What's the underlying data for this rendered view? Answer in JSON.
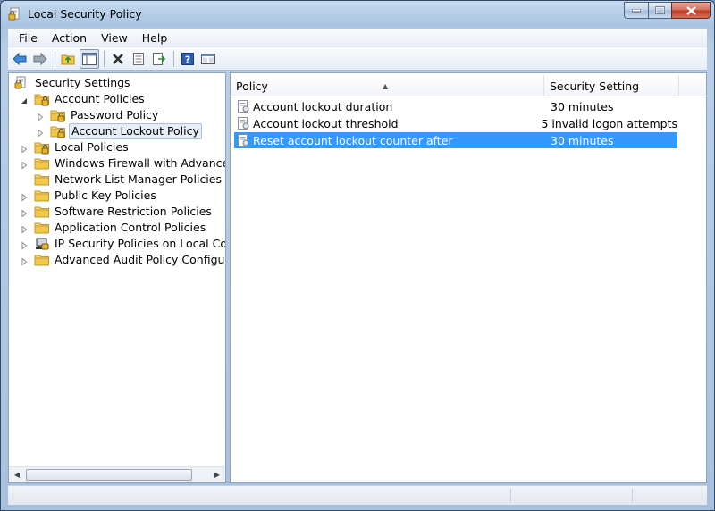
{
  "window": {
    "title": "Local Security Policy",
    "caption_buttons": [
      "minimize",
      "maximize",
      "close"
    ]
  },
  "menu": {
    "items": [
      {
        "label": "File"
      },
      {
        "label": "Action"
      },
      {
        "label": "View"
      },
      {
        "label": "Help"
      }
    ]
  },
  "toolbar": {
    "buttons": [
      {
        "icon": "back-arrow-icon"
      },
      {
        "icon": "forward-arrow-icon"
      },
      {
        "icon": "up-folder-icon"
      },
      {
        "icon": "show-hide-tree-icon",
        "pressed": true
      },
      {
        "icon": "delete-icon"
      },
      {
        "icon": "properties-icon"
      },
      {
        "icon": "export-list-icon"
      },
      {
        "icon": "help-icon"
      },
      {
        "icon": "mmc-view-icon"
      }
    ]
  },
  "tree": {
    "items": [
      {
        "label": "Security Settings",
        "level": 0,
        "icon": "security-settings-icon",
        "expander": "none"
      },
      {
        "label": "Account Policies",
        "level": 1,
        "icon": "folder-lock-icon",
        "expander": "expanded"
      },
      {
        "label": "Password Policy",
        "level": 2,
        "icon": "folder-lock-icon",
        "expander": "collapsed"
      },
      {
        "label": "Account Lockout Policy",
        "level": 2,
        "icon": "folder-lock-icon",
        "expander": "collapsed",
        "selected": true
      },
      {
        "label": "Local Policies",
        "level": 1,
        "icon": "folder-lock-icon",
        "expander": "collapsed"
      },
      {
        "label": "Windows Firewall with Advanced Secu",
        "level": 1,
        "icon": "folder-icon",
        "expander": "collapsed"
      },
      {
        "label": "Network List Manager Policies",
        "level": 1,
        "icon": "folder-icon",
        "expander": "none"
      },
      {
        "label": "Public Key Policies",
        "level": 1,
        "icon": "folder-icon",
        "expander": "collapsed"
      },
      {
        "label": "Software Restriction Policies",
        "level": 1,
        "icon": "folder-icon",
        "expander": "collapsed"
      },
      {
        "label": "Application Control Policies",
        "level": 1,
        "icon": "folder-icon",
        "expander": "collapsed"
      },
      {
        "label": "IP Security Policies on Local Compute",
        "level": 1,
        "icon": "ip-security-icon",
        "expander": "collapsed"
      },
      {
        "label": "Advanced Audit Policy Configuration",
        "level": 1,
        "icon": "folder-icon",
        "expander": "collapsed"
      }
    ]
  },
  "list": {
    "columns": [
      {
        "label": "Policy"
      },
      {
        "label": "Security Setting"
      }
    ],
    "rows": [
      {
        "policy": "Account lockout duration",
        "setting": "30 minutes",
        "icon": "policy-icon"
      },
      {
        "policy": "Account lockout threshold",
        "setting": "5 invalid logon attempts",
        "icon": "policy-icon"
      },
      {
        "policy": "Reset account lockout counter after",
        "setting": "30 minutes",
        "icon": "policy-icon",
        "selected": true
      }
    ]
  },
  "colors": {
    "selection": "#3399ff",
    "title_gradient_top": "#c5d9ee",
    "folder": "#f2c84b"
  }
}
